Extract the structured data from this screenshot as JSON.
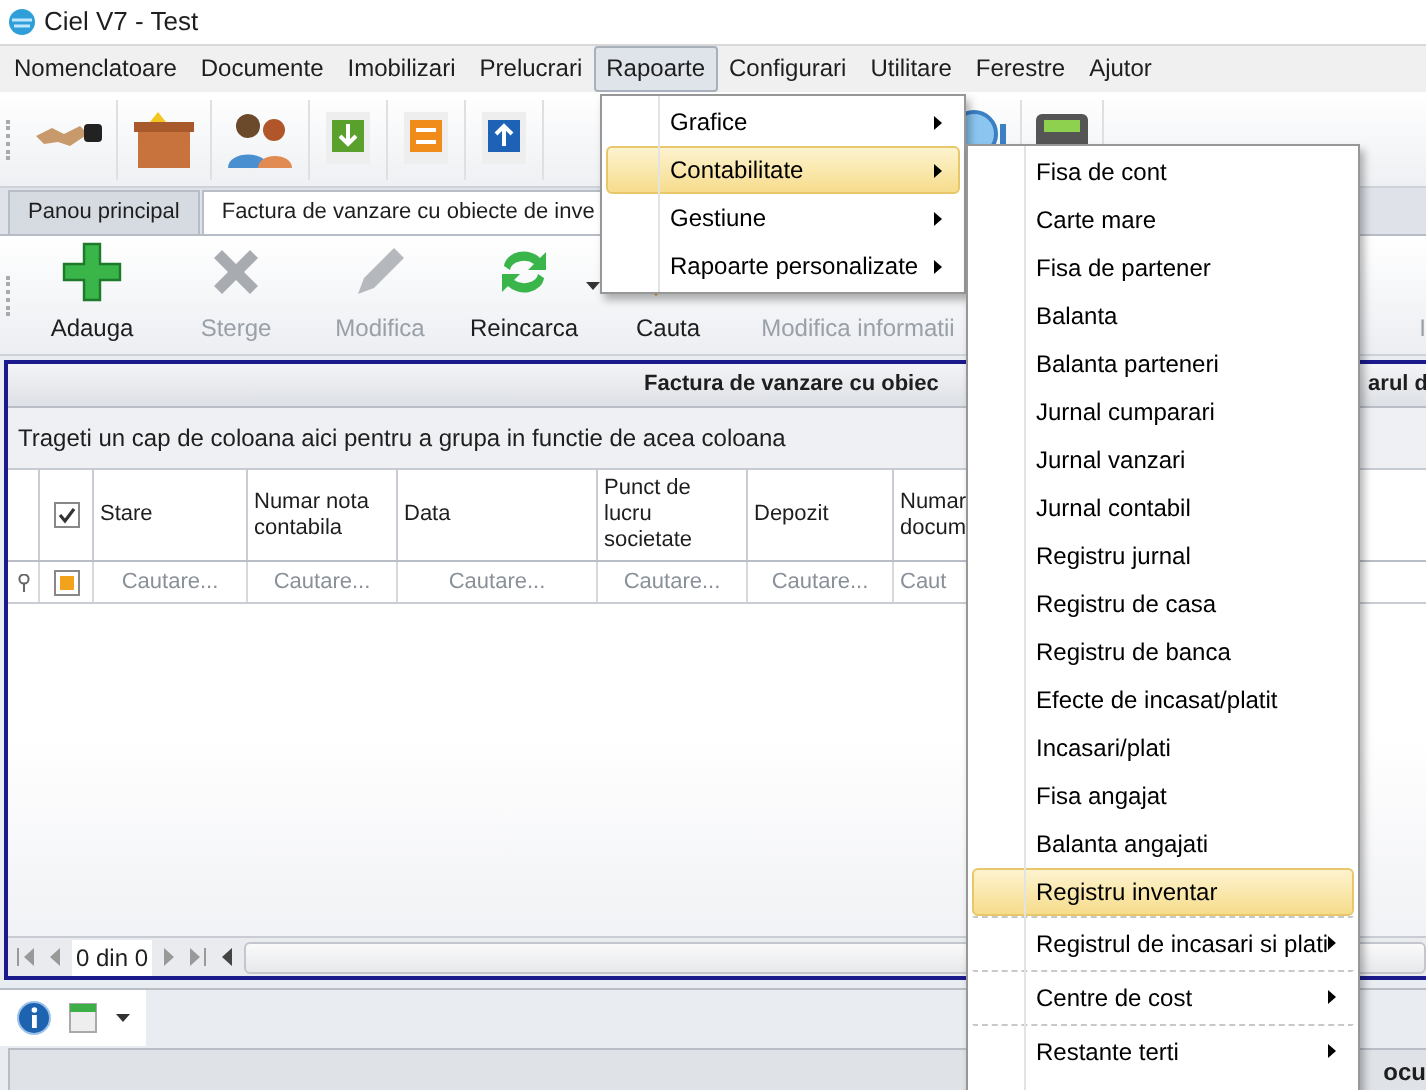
{
  "window": {
    "title": "Ciel V7 - Test"
  },
  "menu_bar": [
    {
      "label": "Nomenclatoare",
      "selected": false
    },
    {
      "label": "Documente",
      "selected": false
    },
    {
      "label": "Imobilizari",
      "selected": false
    },
    {
      "label": "Prelucrari",
      "selected": false
    },
    {
      "label": "Rapoarte",
      "selected": true
    },
    {
      "label": "Configurari",
      "selected": false
    },
    {
      "label": "Utilitare",
      "selected": false
    },
    {
      "label": "Ferestre",
      "selected": false
    },
    {
      "label": "Ajutor",
      "selected": false
    }
  ],
  "tabs": [
    {
      "label": "Panou principal",
      "selected": false
    },
    {
      "label": "Factura de vanzare cu obiecte de inve",
      "selected": true
    }
  ],
  "actions": [
    {
      "label": "Adauga",
      "disabled": false,
      "has_dropdown": false
    },
    {
      "label": "Sterge",
      "disabled": true,
      "has_dropdown": false
    },
    {
      "label": "Modifica",
      "disabled": true,
      "has_dropdown": false
    },
    {
      "label": "Reincarca",
      "disabled": false,
      "has_dropdown": true
    },
    {
      "label": "Cauta",
      "disabled": false,
      "has_dropdown": false
    },
    {
      "label": "Modifica informatii",
      "disabled": true,
      "has_dropdown": false
    },
    {
      "label": "I",
      "disabled": true,
      "has_dropdown": false
    }
  ],
  "grid": {
    "title": "Factura de vanzare cu obiec",
    "title_tail": "arul d",
    "group_hint": "Trageti un cap de coloana aici pentru a grupa in functie de acea coloana",
    "select_all_checked": true,
    "columns": [
      {
        "label": "Stare",
        "filter_placeholder": "Cautare..."
      },
      {
        "label": "Numar nota contabila",
        "filter_placeholder": "Cautare..."
      },
      {
        "label": "Data",
        "filter_placeholder": "Cautare..."
      },
      {
        "label": "Punct de lucru societate",
        "filter_placeholder": "Cautare..."
      },
      {
        "label": "Depozit",
        "filter_placeholder": "Cautare..."
      },
      {
        "label": "Numar docum",
        "filter_placeholder": "Caut"
      }
    ],
    "pager": "0 din 0"
  },
  "bottom_panel": {
    "text_tail": "ocu"
  },
  "reports_menu": [
    {
      "label": "Grafice",
      "selected": false,
      "kind": "submenu"
    },
    {
      "label": "Contabilitate",
      "selected": true,
      "kind": "submenu"
    },
    {
      "label": "Gestiune",
      "selected": false,
      "kind": "submenu"
    },
    {
      "label": "Rapoarte personalizate",
      "selected": false,
      "kind": "submenu"
    }
  ],
  "accounting_menu": [
    {
      "label": "Fisa de cont",
      "selected": false,
      "kind": "item"
    },
    {
      "label": "Carte mare",
      "selected": false,
      "kind": "item"
    },
    {
      "label": "Fisa de partener",
      "selected": false,
      "kind": "item"
    },
    {
      "label": "Balanta",
      "selected": false,
      "kind": "item"
    },
    {
      "label": "Balanta parteneri",
      "selected": false,
      "kind": "item"
    },
    {
      "label": "Jurnal cumparari",
      "selected": false,
      "kind": "item"
    },
    {
      "label": "Jurnal vanzari",
      "selected": false,
      "kind": "item"
    },
    {
      "label": "Jurnal contabil",
      "selected": false,
      "kind": "item"
    },
    {
      "label": "Registru jurnal",
      "selected": false,
      "kind": "item"
    },
    {
      "label": "Registru de casa",
      "selected": false,
      "kind": "item"
    },
    {
      "label": "Registru de banca",
      "selected": false,
      "kind": "item"
    },
    {
      "label": "Efecte de incasat/platit",
      "selected": false,
      "kind": "item"
    },
    {
      "label": "Incasari/plati",
      "selected": false,
      "kind": "item"
    },
    {
      "label": "Fisa angajat",
      "selected": false,
      "kind": "item"
    },
    {
      "label": "Balanta angajati",
      "selected": false,
      "kind": "item"
    },
    {
      "label": "Registru inventar",
      "selected": true,
      "kind": "item"
    },
    {
      "label": "Registrul de incasari si plati",
      "selected": false,
      "kind": "submenu"
    },
    {
      "label": "Centre de cost",
      "selected": false,
      "kind": "submenu"
    },
    {
      "label": "Restante terti",
      "selected": false,
      "kind": "submenu"
    }
  ]
}
